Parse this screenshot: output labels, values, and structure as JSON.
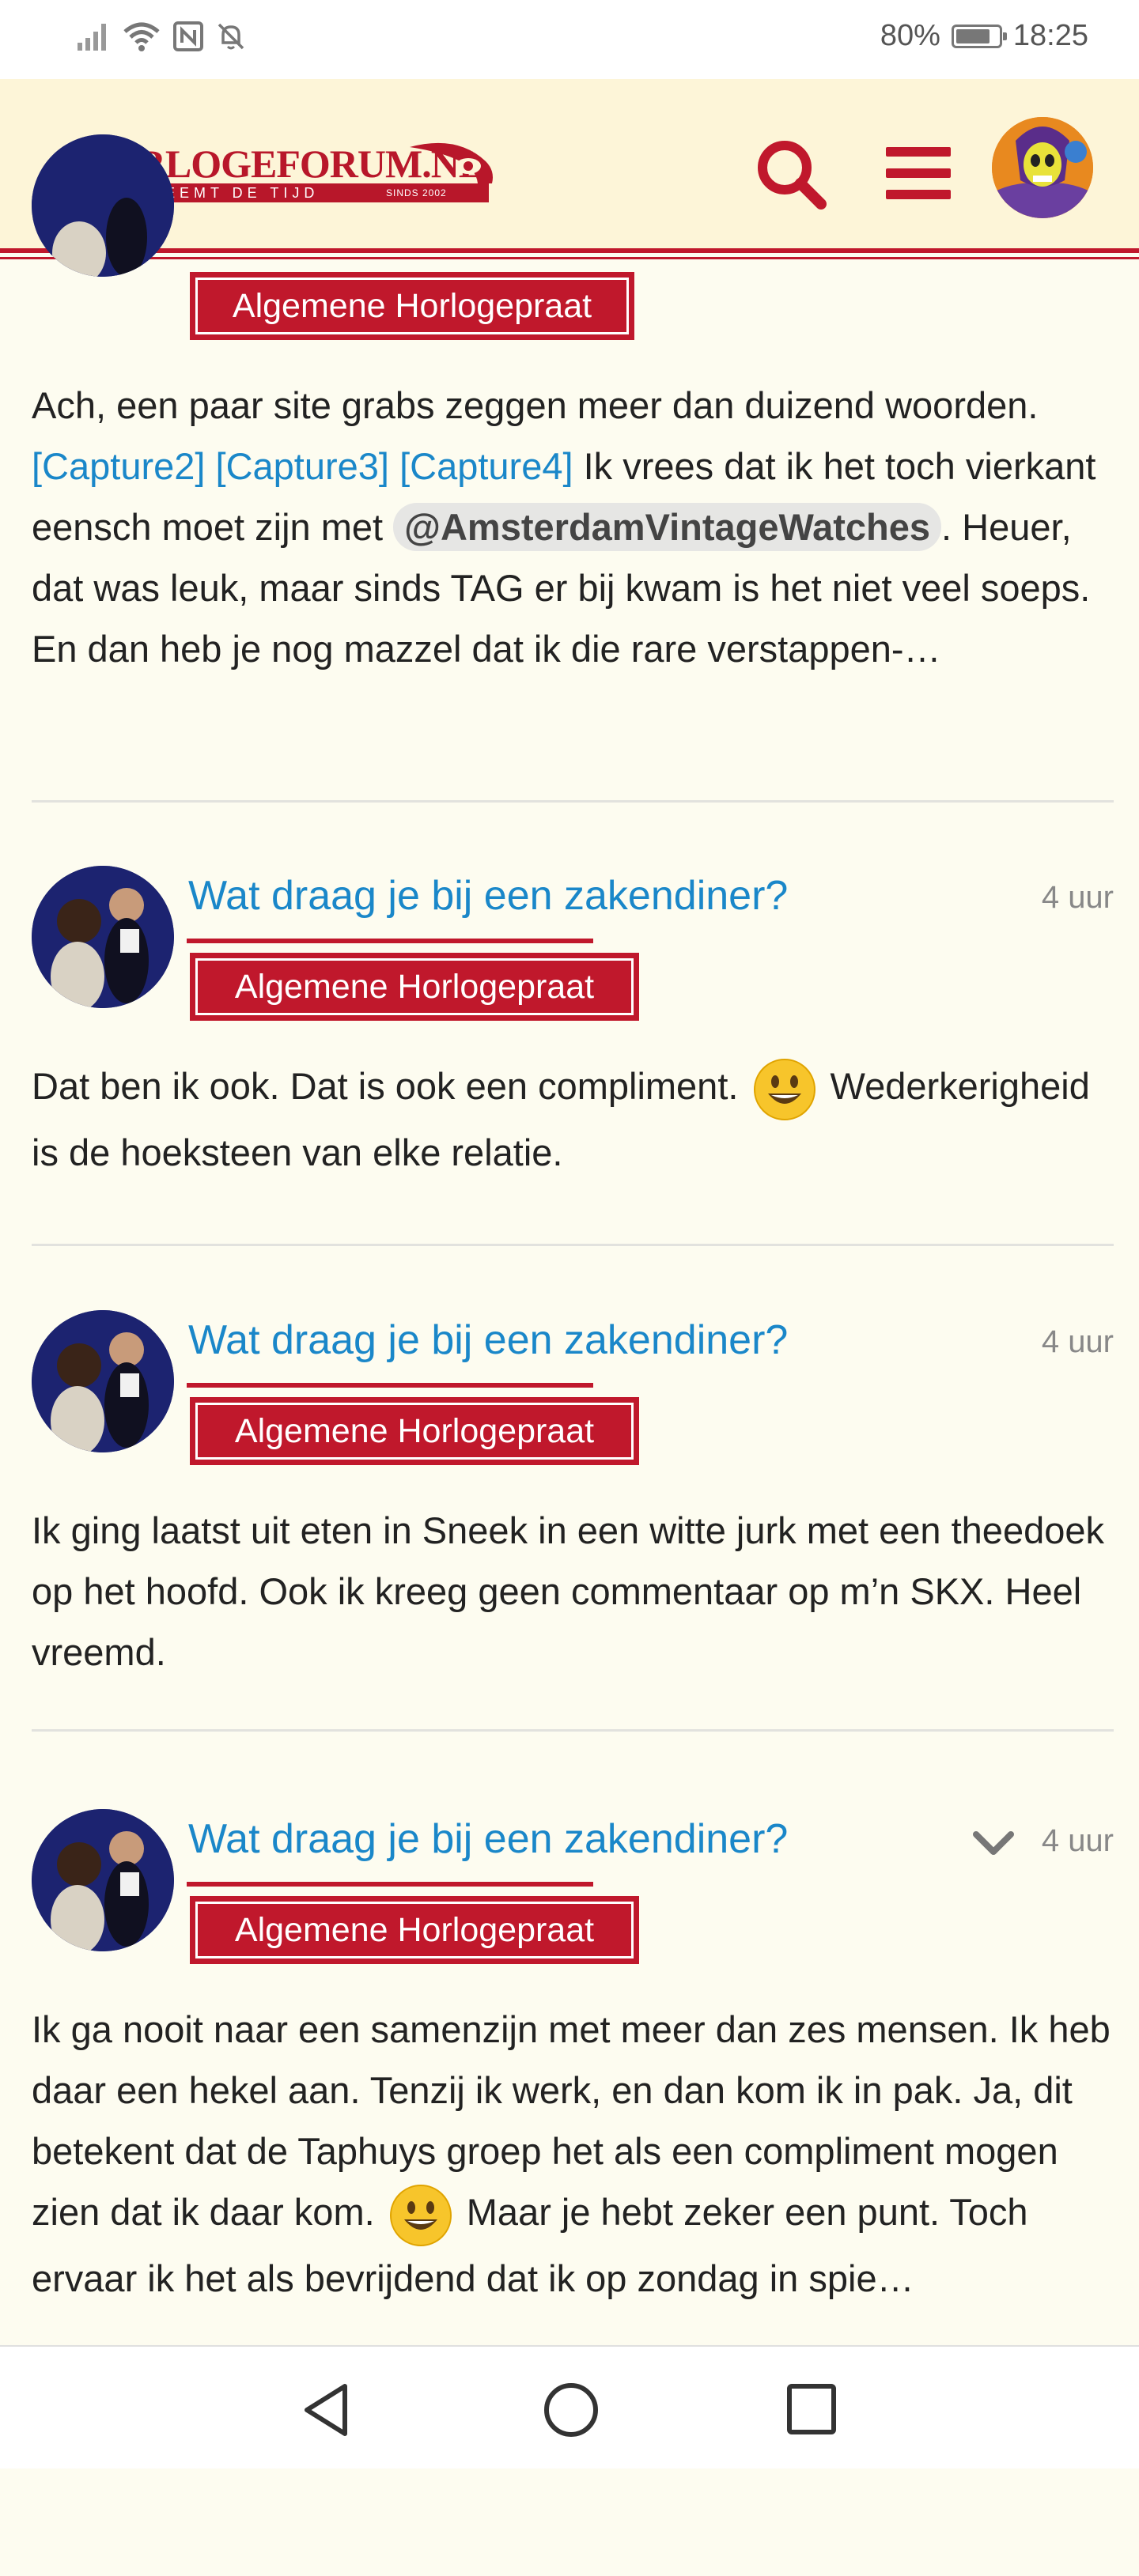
{
  "status_bar": {
    "battery_text": "80%",
    "battery_level": 0.8,
    "time": "18:25",
    "icons": [
      "signal-icon",
      "wifi-icon",
      "nfc-icon",
      "bell-muted-icon",
      "battery-icon"
    ]
  },
  "header": {
    "logo_title": "HORLOGEFORUM.NL",
    "logo_tagline": "NEEMT DE TIJD",
    "logo_since": "SINDS 2002",
    "icons": [
      "search-icon",
      "menu-icon",
      "user-avatar"
    ],
    "accent_color": "#c0182c",
    "background_color": "#fdf5d8"
  },
  "posts": [
    {
      "category": "Algemene Horlogepraat",
      "body": {
        "t1": "Ach, een paar site grabs zeggen meer dan duizend woorden. ",
        "link1": "[Capture2]",
        "link2": "[Capture3]",
        "link3": "[Capture4]",
        "t2": " Ik vrees dat ik het toch vierkant eensch moet zijn met ",
        "mention": "@AmsterdamVintageWatches",
        "t3": ". Heuer, dat was leuk, maar sinds TAG er bij kwam is het niet veel soeps. En dan heb je nog mazzel dat ik die rare verstappen-…"
      }
    },
    {
      "title": "Wat draag je bij een zakendiner?",
      "time": "4 uur",
      "category": "Algemene Horlogepraat",
      "body": {
        "t1": "Dat ben ik ook. Dat is ook een compliment. ",
        "t2": " Wederkerigheid is de hoeksteen van elke relatie."
      }
    },
    {
      "title": "Wat draag je bij een zakendiner?",
      "time": "4 uur",
      "category": "Algemene Horlogepraat",
      "body": {
        "t1": "Ik ging laatst uit eten in Sneek in een witte jurk met een theedoek op het hoofd. Ook ik kreeg geen commentaar op m’n SKX. Heel vreemd."
      }
    },
    {
      "title": "Wat draag je bij een zakendiner?",
      "time": "4 uur",
      "category": "Algemene Horlogepraat",
      "body": {
        "t1": "Ik ga nooit naar een samenzijn met meer dan zes mensen. Ik heb daar een hekel aan. Tenzij ik werk, en dan kom ik in pak. Ja, dit betekent dat de Taphuys groep het als een compliment mogen zien dat ik daar kom. ",
        "t2": " Maar je hebt zeker een punt. Toch ervaar ik het als bevrijdend dat ik op zondag in spie…"
      }
    }
  ],
  "nav_bar": {
    "icons": [
      "back-icon",
      "home-icon",
      "recents-icon"
    ]
  }
}
